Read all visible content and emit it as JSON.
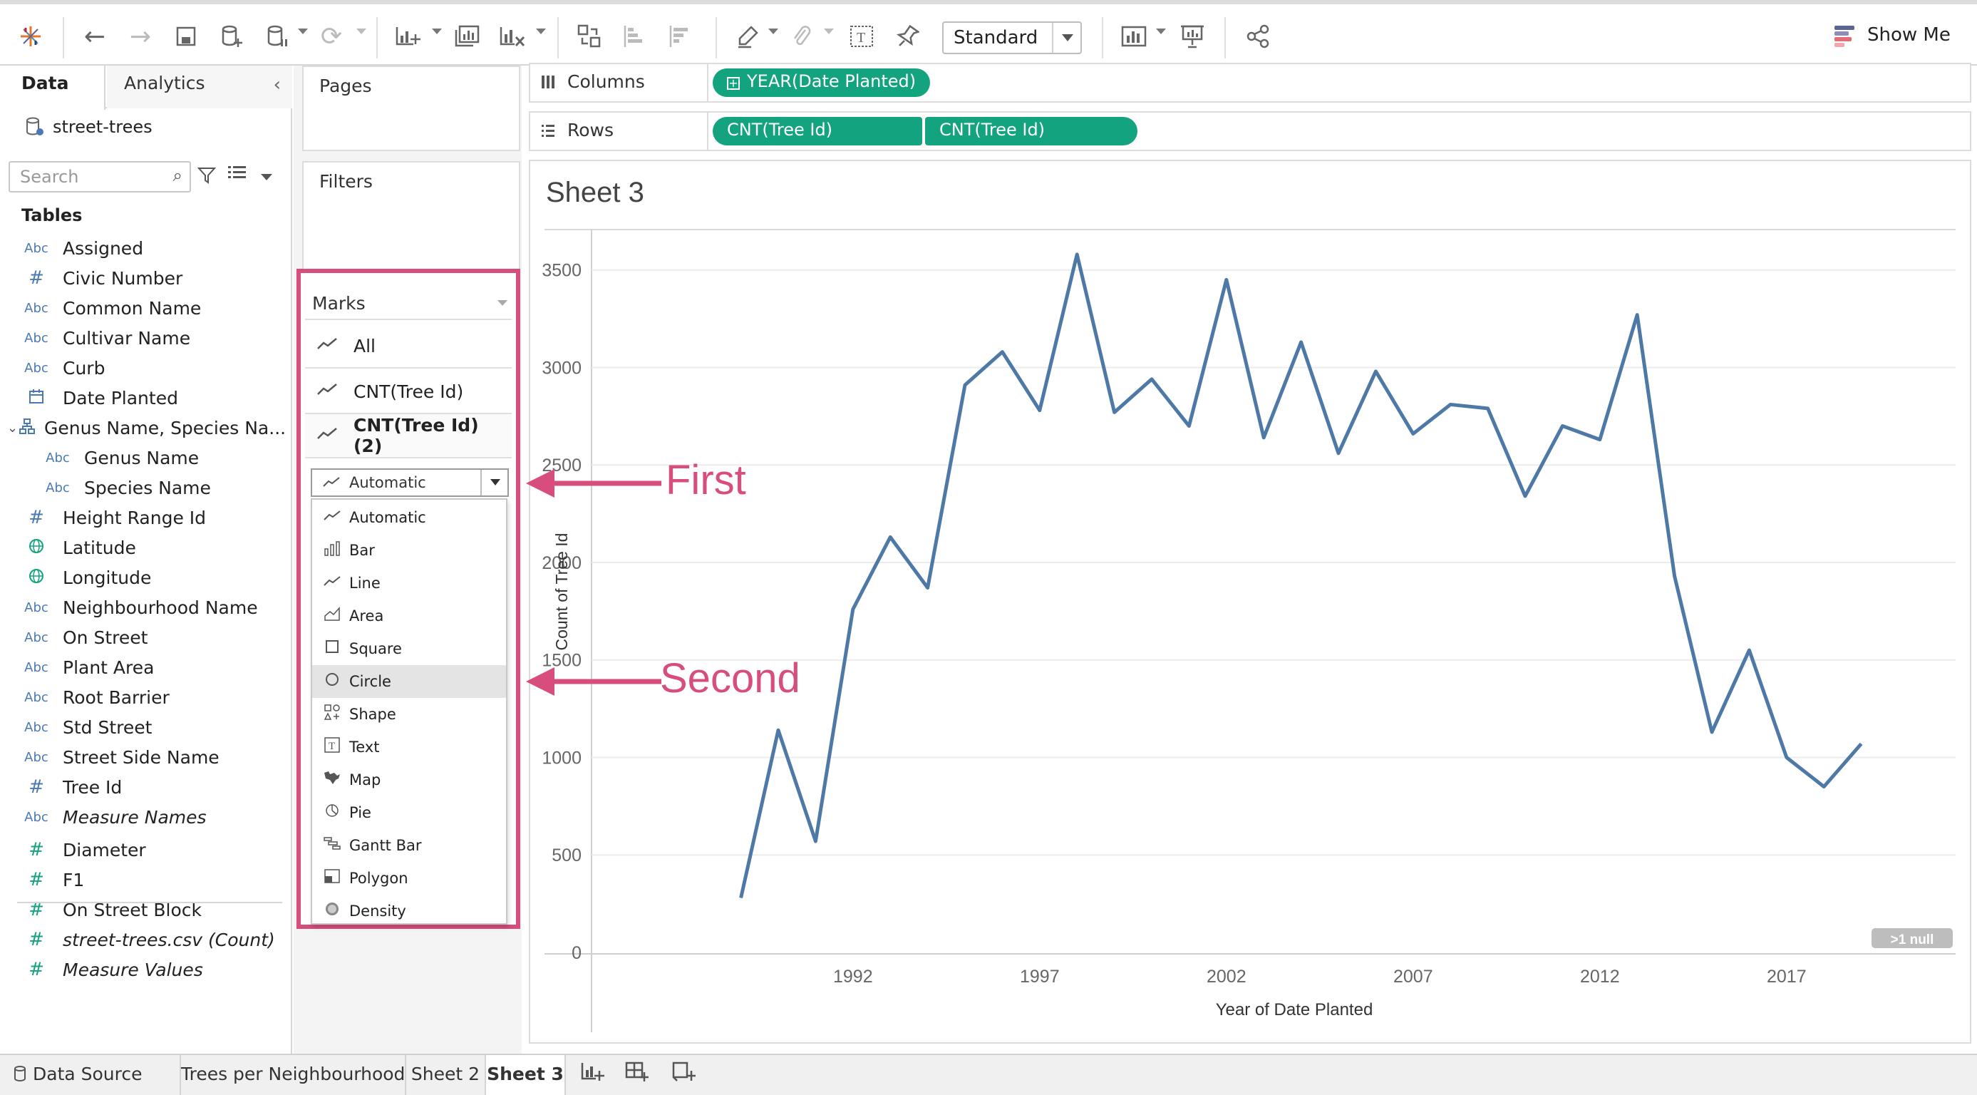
{
  "toolbar": {
    "view_mode": "Standard",
    "show_me": "Show Me"
  },
  "data_pane": {
    "tab_data": "Data",
    "tab_analytics": "Analytics",
    "datasource": "street-trees",
    "search_placeholder": "Search",
    "tables_heading": "Tables",
    "fields": [
      {
        "type": "Abc",
        "name": "Assigned"
      },
      {
        "type": "#",
        "name": "Civic Number"
      },
      {
        "type": "Abc",
        "name": "Common Name"
      },
      {
        "type": "Abc",
        "name": "Cultivar Name"
      },
      {
        "type": "Abc",
        "name": "Curb"
      },
      {
        "type": "date",
        "name": "Date Planted"
      },
      {
        "type": "hier",
        "name": "Genus Name, Species Na..."
      },
      {
        "type": "Abc",
        "name": "Genus Name"
      },
      {
        "type": "Abc",
        "name": "Species Name"
      },
      {
        "type": "#",
        "name": "Height Range Id"
      },
      {
        "type": "geo",
        "name": "Latitude"
      },
      {
        "type": "geo",
        "name": "Longitude"
      },
      {
        "type": "Abc",
        "name": "Neighbourhood Name"
      },
      {
        "type": "Abc",
        "name": "On Street"
      },
      {
        "type": "Abc",
        "name": "Plant Area"
      },
      {
        "type": "Abc",
        "name": "Root Barrier"
      },
      {
        "type": "Abc",
        "name": "Std Street"
      },
      {
        "type": "Abc",
        "name": "Street Side Name"
      },
      {
        "type": "#",
        "name": "Tree Id"
      },
      {
        "type": "Abc",
        "name": "Measure Names"
      },
      {
        "type": "#",
        "name": "Diameter"
      },
      {
        "type": "#",
        "name": "F1"
      },
      {
        "type": "#",
        "name": "On Street Block"
      },
      {
        "type": "#",
        "name": "street-trees.csv (Count)"
      },
      {
        "type": "#",
        "name": "Measure Values"
      }
    ]
  },
  "cards": {
    "pages": "Pages",
    "filters": "Filters",
    "marks": "Marks",
    "marks_rows": [
      "All",
      "CNT(Tree Id)",
      "CNT(Tree Id) (2)"
    ],
    "mark_type_selected": "Automatic",
    "mark_types": [
      "Automatic",
      "Bar",
      "Line",
      "Area",
      "Square",
      "Circle",
      "Shape",
      "Text",
      "Map",
      "Pie",
      "Gantt Bar",
      "Polygon",
      "Density"
    ]
  },
  "shelves": {
    "columns_label": "Columns",
    "rows_label": "Rows",
    "columns_pill": "YEAR(Date Planted)",
    "rows_pill_1": "CNT(Tree Id)",
    "rows_pill_2": "CNT(Tree Id)"
  },
  "sheet": {
    "title": "Sheet 3",
    "null_badge": ">1 null"
  },
  "annotations": {
    "first": "First",
    "second": "Second"
  },
  "bottom_tabs": {
    "data_source": "Data Source",
    "tab1": "Trees per Neighbourhood",
    "tab2": "Sheet 2",
    "tab3": "Sheet 3"
  },
  "chart_data": {
    "type": "line",
    "xlabel": "Year of Date Planted",
    "ylabel": "Count of Tree Id",
    "x": [
      1989,
      1990,
      1991,
      1992,
      1993,
      1994,
      1995,
      1996,
      1997,
      1998,
      1999,
      2000,
      2001,
      2002,
      2003,
      2004,
      2005,
      2006,
      2007,
      2008,
      2009,
      2010,
      2011,
      2012,
      2013,
      2014,
      2015,
      2016,
      2017,
      2018,
      2019
    ],
    "series": [
      {
        "values": [
          280,
          1140,
          570,
          1760,
          2130,
          1870,
          2910,
          3080,
          2780,
          3580,
          2770,
          2940,
          2700,
          3450,
          2640,
          3130,
          2560,
          2980,
          2660,
          2810,
          2790,
          2340,
          2700,
          2630,
          3270,
          1930,
          1130,
          1550,
          1000,
          850,
          1070
        ]
      }
    ],
    "xticks": [
      "1992",
      "1997",
      "2002",
      "2007",
      "2012",
      "2017"
    ],
    "yticks": [
      "0",
      "500",
      "1000",
      "1500",
      "2000",
      "2500",
      "3000",
      "3500"
    ],
    "xlim": [
      1985,
      2020
    ],
    "ylim": [
      0,
      3700
    ],
    "grid": true,
    "line_color": "#4e79a7"
  }
}
